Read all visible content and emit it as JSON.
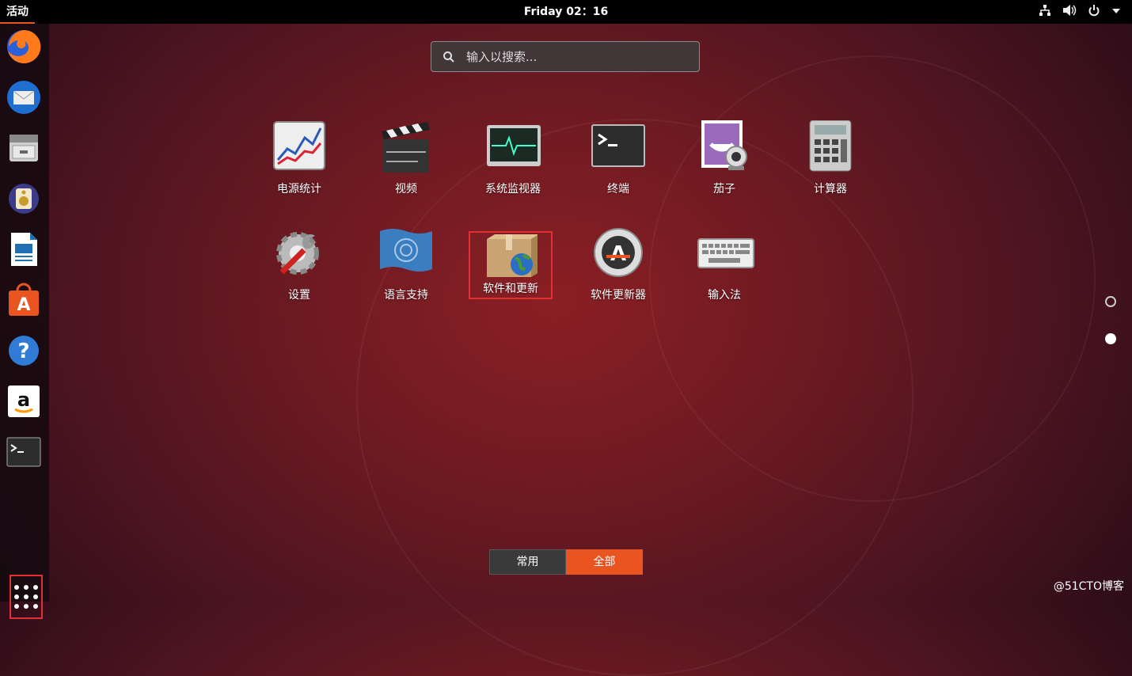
{
  "topbar": {
    "activities": "活动",
    "clock": "Friday 02：16"
  },
  "search": {
    "placeholder": "输入以搜索..."
  },
  "apps": [
    {
      "label": "电源统计"
    },
    {
      "label": "视频"
    },
    {
      "label": "系统监视器"
    },
    {
      "label": "终端"
    },
    {
      "label": "茄子"
    },
    {
      "label": "计算器"
    },
    {
      "label": "设置"
    },
    {
      "label": "语言支持"
    },
    {
      "label": "软件和更新"
    },
    {
      "label": "软件更新器"
    },
    {
      "label": "输入法"
    }
  ],
  "view_switch": {
    "frequent": "常用",
    "all": "全部",
    "selected": "all"
  },
  "watermark": "@51CTO博客",
  "colors": {
    "accent": "#e95420",
    "highlight": "#e03030"
  }
}
